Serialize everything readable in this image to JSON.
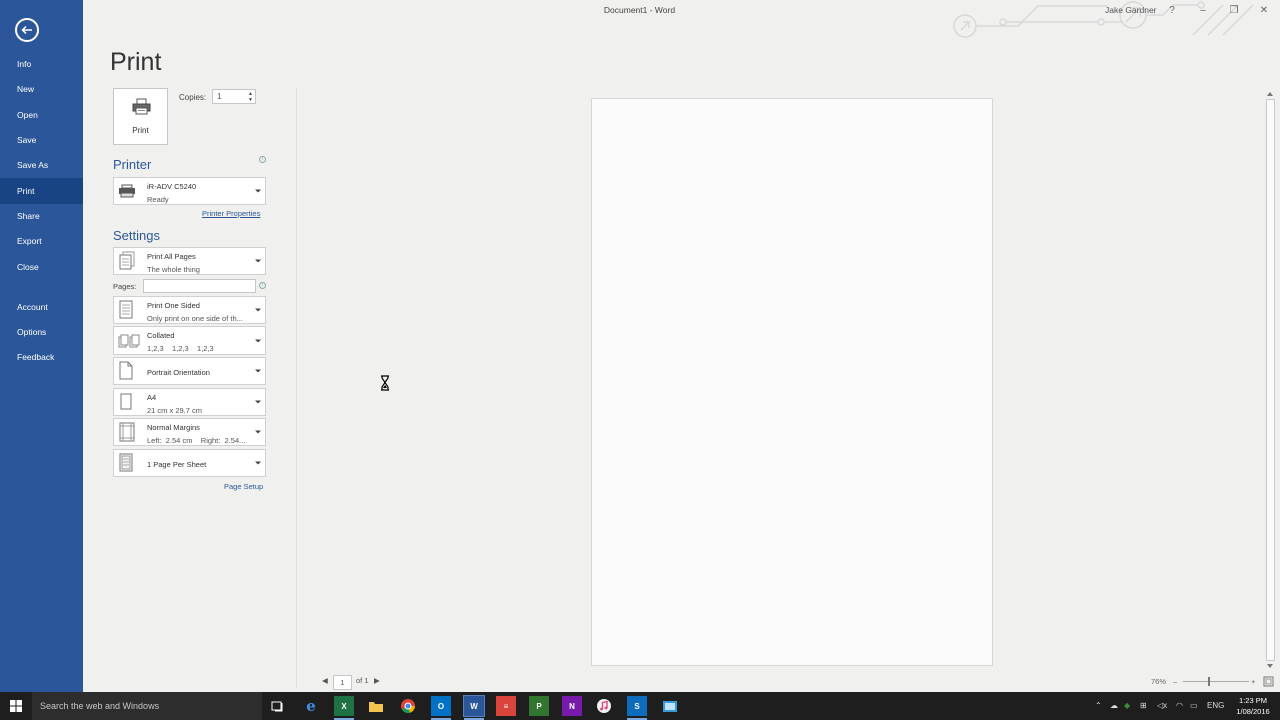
{
  "titlebar": {
    "doc_title": "Document1 - Word",
    "user": "Jake Gardner",
    "help": "?",
    "minimize": "–",
    "restore": "❐",
    "close": "✕"
  },
  "sidebar": {
    "items": [
      {
        "label": "Info"
      },
      {
        "label": "New"
      },
      {
        "label": "Open"
      },
      {
        "label": "Save"
      },
      {
        "label": "Save As"
      },
      {
        "label": "Print",
        "active": true
      },
      {
        "label": "Share"
      },
      {
        "label": "Export"
      },
      {
        "label": "Close"
      },
      {
        "label": "Account"
      },
      {
        "label": "Options"
      },
      {
        "label": "Feedback"
      }
    ]
  },
  "print": {
    "title": "Print",
    "button_label": "Print",
    "copies_label": "Copies:",
    "copies_value": "1"
  },
  "printer": {
    "heading": "Printer",
    "name": "iR-ADV C5240",
    "status": "Ready",
    "properties_link": "Printer Properties"
  },
  "settings": {
    "heading": "Settings",
    "pages_label": "Pages:",
    "pages_value": "",
    "page_setup_link": "Page Setup",
    "options": [
      {
        "main": "Print All Pages",
        "sub": "The whole thing"
      },
      {
        "main": "Print One Sided",
        "sub": "Only print on one side of th..."
      },
      {
        "main": "Collated",
        "sub": "1,2,3    1,2,3    1,2,3"
      },
      {
        "main": "Portrait Orientation",
        "sub": ""
      },
      {
        "main": "A4",
        "sub": "21 cm x 29.7 cm"
      },
      {
        "main": "Normal Margins",
        "sub": "Left:  2.54 cm    Right:  2.54..."
      },
      {
        "main": "1 Page Per Sheet",
        "sub": ""
      }
    ]
  },
  "preview": {
    "current_page": "1",
    "of_pages": "of 1",
    "zoom": "76%",
    "zoom_minus": "–",
    "zoom_plus": "+"
  },
  "taskbar": {
    "search_placeholder": "Search the web and Windows",
    "lang": "ENG",
    "time": "1:23 PM",
    "date": "1/08/2016"
  },
  "colors": {
    "accent": "#2b579a",
    "sidebar_active": "#194483",
    "taskbar": "#1e1e1e"
  }
}
